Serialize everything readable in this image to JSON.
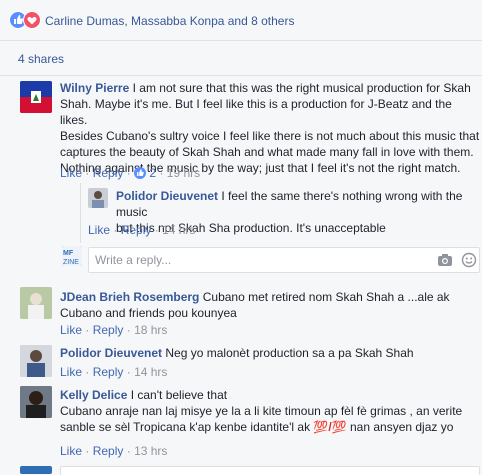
{
  "reactions": {
    "names": "Carline Dumas, Massabba Konpa and 8 others"
  },
  "shares": {
    "label": "4 shares"
  },
  "comments": [
    {
      "author": "Wilny Pierre",
      "lines": [
        "I am not sure that this was the right musical production for Skah",
        "Shah. Maybe it's me. But I feel like this is a production for J-Beatz and the likes.",
        "Besides Cubano's sultry voice I feel like there is not much about this music that",
        "captures the beauty of Skah Shah and what made many fall in love with them.",
        "Nothing against the music by the way; just that I feel it's not the right match."
      ],
      "like": "Like",
      "reply": "Reply",
      "likes_count": "2",
      "time": "19 hrs"
    },
    {
      "author": "Polidor Dieuvenet",
      "lines": [
        "I feel the same there's nothing wrong with the music",
        "but this not Skah Sha production. It's unacceptable"
      ],
      "like": "Like",
      "reply": "Reply",
      "time": "14 hrs"
    },
    {
      "author": "JDean Brieh Rosemberg",
      "lines": [
        "Cubano met retired nom Skah Shah a ...ale ak",
        "Cubano and friends pou kounyea"
      ],
      "like": "Like",
      "reply": "Reply",
      "time": "18 hrs"
    },
    {
      "author": "Polidor Dieuvenet",
      "lines": [
        "Neg yo malonèt production sa a pa Skah Shah"
      ],
      "like": "Like",
      "reply": "Reply",
      "time": "14 hrs"
    },
    {
      "author": "Kelly Delice",
      "lines": [
        "I can't believe that",
        "Cubano anraje nan laj misye ye la a li kite timoun ap fèl fè grimas , an verite",
        "sanble se sèl Tropicana k'ap kenbe idantite'l ak",
        "nan ansyen djaz yo"
      ],
      "emoji": "💯/💯",
      "like": "Like",
      "reply": "Reply",
      "time": "13 hrs"
    }
  ],
  "reply_input": {
    "placeholder": "Write a reply..."
  },
  "separator": "·",
  "colors": {
    "link": "#385898",
    "meta": "#90949c",
    "like_blue": "#4267b2"
  },
  "icons": [
    "like-icon",
    "love-icon",
    "like-small-icon",
    "camera-icon",
    "emoji-icon"
  ]
}
